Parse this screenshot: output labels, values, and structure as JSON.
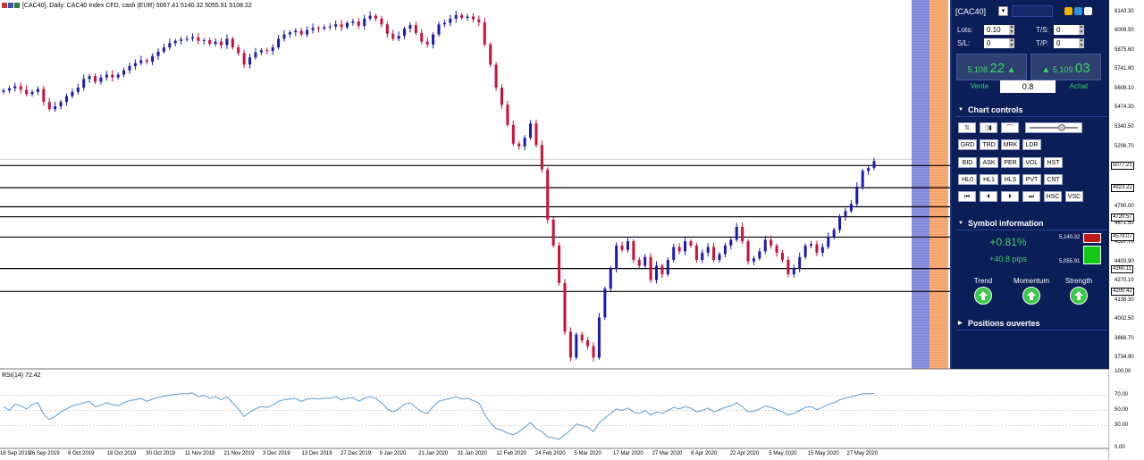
{
  "chart": {
    "title": "[CAC40], Daily:  CAC40 Index CFD, cash (EUR)  5067.41 5140.32 5055.91 5108.22",
    "rsi_label": "RSI(14) 72.42",
    "y_ticks": [
      "6143.30",
      "6009.50",
      "5875.60",
      "5741.80",
      "5608.10",
      "5474.30",
      "5340.50",
      "5206.70",
      "4790.00",
      "4671.50",
      "4537.70",
      "4403.90",
      "4270.10",
      "4136.30",
      "4002.50",
      "3868.70",
      "3734.90"
    ],
    "level_tags": [
      "5077.21",
      "4923.22",
      "4720.57",
      "4579.07",
      "4360.11",
      "4200.42"
    ],
    "rsi_ticks": [
      "100.00",
      "70.00",
      "50.00",
      "30.00",
      "0.00"
    ],
    "x_ticks": [
      "16 Sep 2019",
      "26 Sep 2019",
      "8 Oct 2019",
      "18 Oct 2019",
      "30 Oct 2019",
      "11 Nov 2019",
      "21 Nov 2019",
      "3 Dec 2019",
      "13 Dec 2019",
      "27 Dec 2019",
      "9 Jan 2020",
      "21 Jan 2020",
      "31 Jan 2020",
      "12 Feb 2020",
      "24 Feb 2020",
      "5 Mar 2020",
      "17 Mar 2020",
      "27 Mar 2020",
      "8 Apr 2020",
      "22 Apr 2020",
      "5 May 2020",
      "15 May 2020",
      "27 May 2020"
    ]
  },
  "chart_data": {
    "type": "candlestick",
    "title": "[CAC40], Daily:  CAC40 Index CFD, cash (EUR)  5067.41 5140.32 5055.91 5108.22",
    "ylim": [
      3680,
      6180
    ],
    "close": [
      5600,
      5615,
      5630,
      5605,
      5575,
      5590,
      5610,
      5520,
      5470,
      5490,
      5520,
      5560,
      5590,
      5620,
      5680,
      5700,
      5660,
      5690,
      5710,
      5690,
      5710,
      5740,
      5770,
      5790,
      5810,
      5800,
      5840,
      5870,
      5900,
      5930,
      5945,
      5955,
      5960,
      5970,
      5945,
      5950,
      5925,
      5940,
      5915,
      5960,
      5900,
      5860,
      5780,
      5830,
      5865,
      5880,
      5875,
      5900,
      5960,
      5990,
      6005,
      6015,
      5990,
      6020,
      6035,
      6030,
      6040,
      6045,
      6060,
      6040,
      6070,
      6080,
      6050,
      6100,
      6120,
      6100,
      6060,
      5995,
      5960,
      5980,
      6030,
      6055,
      6000,
      5940,
      5920,
      5990,
      6060,
      6070,
      6100,
      6125,
      6105,
      6115,
      6095,
      6075,
      5920,
      5780,
      5620,
      5500,
      5360,
      5230,
      5210,
      5270,
      5370,
      5220,
      5050,
      4700,
      4520,
      4260,
      3920,
      3740,
      3900,
      3860,
      3820,
      3740,
      4020,
      4220,
      4360,
      4520,
      4490,
      4550,
      4420,
      4380,
      4440,
      4280,
      4380,
      4320,
      4420,
      4510,
      4480,
      4550,
      4520,
      4420,
      4470,
      4510,
      4420,
      4460,
      4520,
      4560,
      4650,
      4550,
      4410,
      4430,
      4480,
      4560,
      4520,
      4470,
      4420,
      4320,
      4360,
      4440,
      4520,
      4530,
      4470,
      4510,
      4580,
      4630,
      4720,
      4760,
      4810,
      4930,
      5040,
      5060,
      5108
    ],
    "rsi": [
      55,
      50,
      58,
      56,
      52,
      58,
      60,
      45,
      38,
      42,
      48,
      52,
      56,
      58,
      60,
      62,
      55,
      57,
      60,
      58,
      56,
      60,
      63,
      64,
      66,
      62,
      65,
      67,
      69,
      70,
      71,
      72,
      72,
      73,
      68,
      70,
      66,
      68,
      64,
      68,
      60,
      52,
      42,
      48,
      52,
      55,
      54,
      57,
      62,
      64,
      65,
      66,
      62,
      65,
      66,
      65,
      66,
      66,
      68,
      64,
      66,
      67,
      62,
      66,
      68,
      66,
      60,
      52,
      48,
      52,
      58,
      60,
      54,
      48,
      46,
      55,
      62,
      64,
      66,
      68,
      65,
      66,
      63,
      60,
      45,
      34,
      26,
      24,
      20,
      18,
      22,
      28,
      34,
      26,
      22,
      15,
      14,
      12,
      18,
      24,
      32,
      30,
      28,
      22,
      34,
      40,
      46,
      52,
      50,
      53,
      48,
      46,
      50,
      44,
      48,
      46,
      50,
      54,
      52,
      55,
      53,
      48,
      50,
      53,
      48,
      51,
      54,
      56,
      60,
      55,
      48,
      49,
      52,
      56,
      54,
      51,
      48,
      44,
      46,
      50,
      54,
      55,
      51,
      54,
      58,
      60,
      64,
      66,
      68,
      70,
      72,
      72,
      72.42
    ]
  },
  "panel": {
    "symbol": "[CAC40]",
    "lots_label": "Lots:",
    "lots_value": "0.10",
    "sl_label": "S/L:",
    "sl_value": "0",
    "ts_label": "T/S:",
    "ts_value": "0",
    "tp_label": "T/P:",
    "tp_value": "0",
    "sell_price_prefix": "5,108.",
    "sell_price_big": "22",
    "buy_price_prefix": "5,109.",
    "buy_price_big": "03",
    "sell_label": "Vente",
    "buy_label": "Achat",
    "spread": "0.8",
    "chart_controls": "Chart controls",
    "buttons_row1": [
      "GRD",
      "TRD",
      "MRK",
      "LDR"
    ],
    "buttons_row2": [
      "BID",
      "ASK",
      "PER",
      "VOL",
      "HST"
    ],
    "buttons_row3": [
      "HL0",
      "HL1",
      "HLS",
      "PVT",
      "CNT"
    ],
    "buttons_row4": [
      "HSC",
      "VSC"
    ],
    "symbol_information": "Symbol information",
    "change_pct": "+0.81%",
    "change_pips": "+40.8 pips",
    "high": "5,140.32",
    "low": "5,055.91",
    "trend": "Trend",
    "momentum": "Momentum",
    "strength": "Strength",
    "positions": "Positions ouvertes",
    "colors": {
      "panel_bg": "#0b1e58",
      "green": "#3cd467",
      "red_box": "#c0191b",
      "green_box": "#14c814"
    }
  }
}
